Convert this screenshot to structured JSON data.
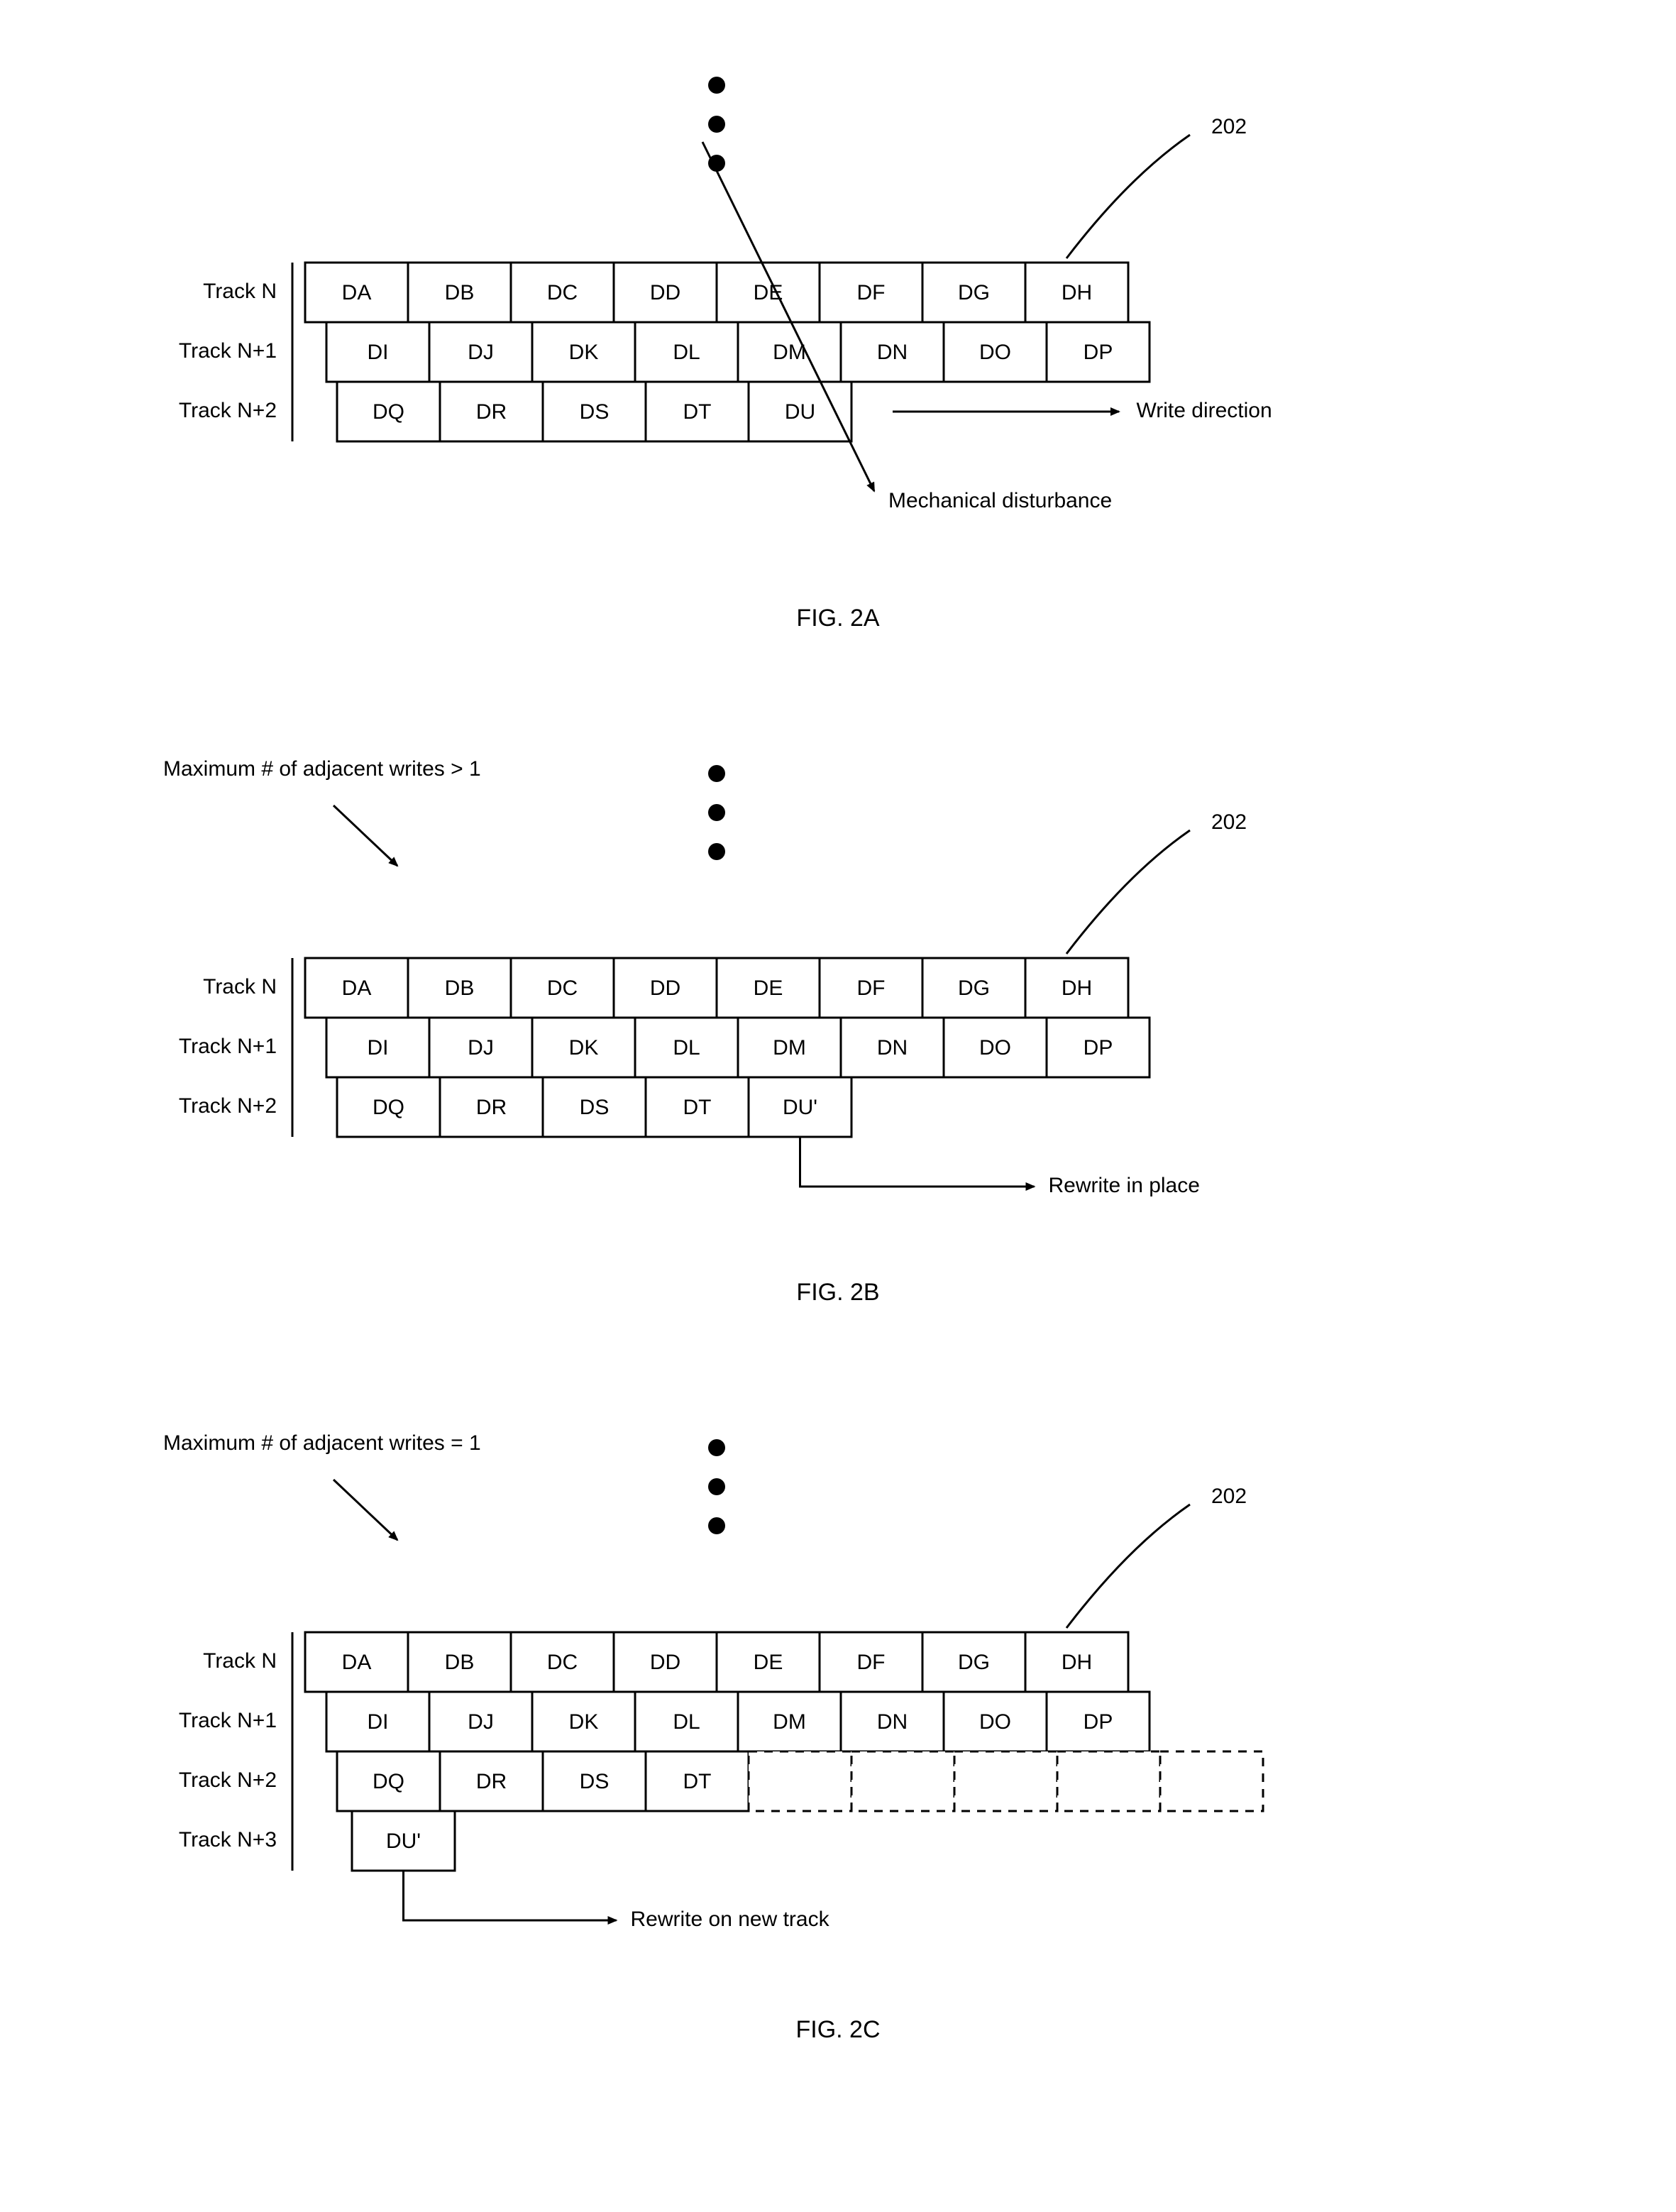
{
  "refnum": "202",
  "figureA": {
    "caption": "FIG. 2A",
    "tracks": [
      "Track N",
      "Track N+1",
      "Track N+2"
    ],
    "row0": [
      "DA",
      "DB",
      "DC",
      "DD",
      "DE",
      "DF",
      "DG",
      "DH"
    ],
    "row1": [
      "DI",
      "DJ",
      "DK",
      "DL",
      "DM",
      "DN",
      "DO",
      "DP"
    ],
    "row2": [
      "DQ",
      "DR",
      "DS",
      "DT",
      "DU"
    ],
    "du_index": 4,
    "writeDirection": "Write direction",
    "mechDisturbance": "Mechanical disturbance"
  },
  "figureB": {
    "caption": "FIG. 2B",
    "heading": "Maximum # of adjacent writes > 1",
    "tracks": [
      "Track N",
      "Track N+1",
      "Track N+2"
    ],
    "row0": [
      "DA",
      "DB",
      "DC",
      "DD",
      "DE",
      "DF",
      "DG",
      "DH"
    ],
    "row1": [
      "DI",
      "DJ",
      "DK",
      "DL",
      "DM",
      "DN",
      "DO",
      "DP"
    ],
    "row2": [
      "DQ",
      "DR",
      "DS",
      "DT",
      "DU'"
    ],
    "rewrite": "Rewrite in place"
  },
  "figureC": {
    "caption": "FIG. 2C",
    "heading": "Maximum # of adjacent writes = 1",
    "tracks": [
      "Track N",
      "Track N+1",
      "Track N+2",
      "Track N+3"
    ],
    "row0": [
      "DA",
      "DB",
      "DC",
      "DD",
      "DE",
      "DF",
      "DG",
      "DH"
    ],
    "row1": [
      "DI",
      "DJ",
      "DK",
      "DL",
      "DM",
      "DN",
      "DO",
      "DP"
    ],
    "row2": [
      "DQ",
      "DR",
      "DS",
      "DT"
    ],
    "row2_dashed_count": 5,
    "row3": [
      "DU'"
    ],
    "rewrite": "Rewrite on new track"
  }
}
